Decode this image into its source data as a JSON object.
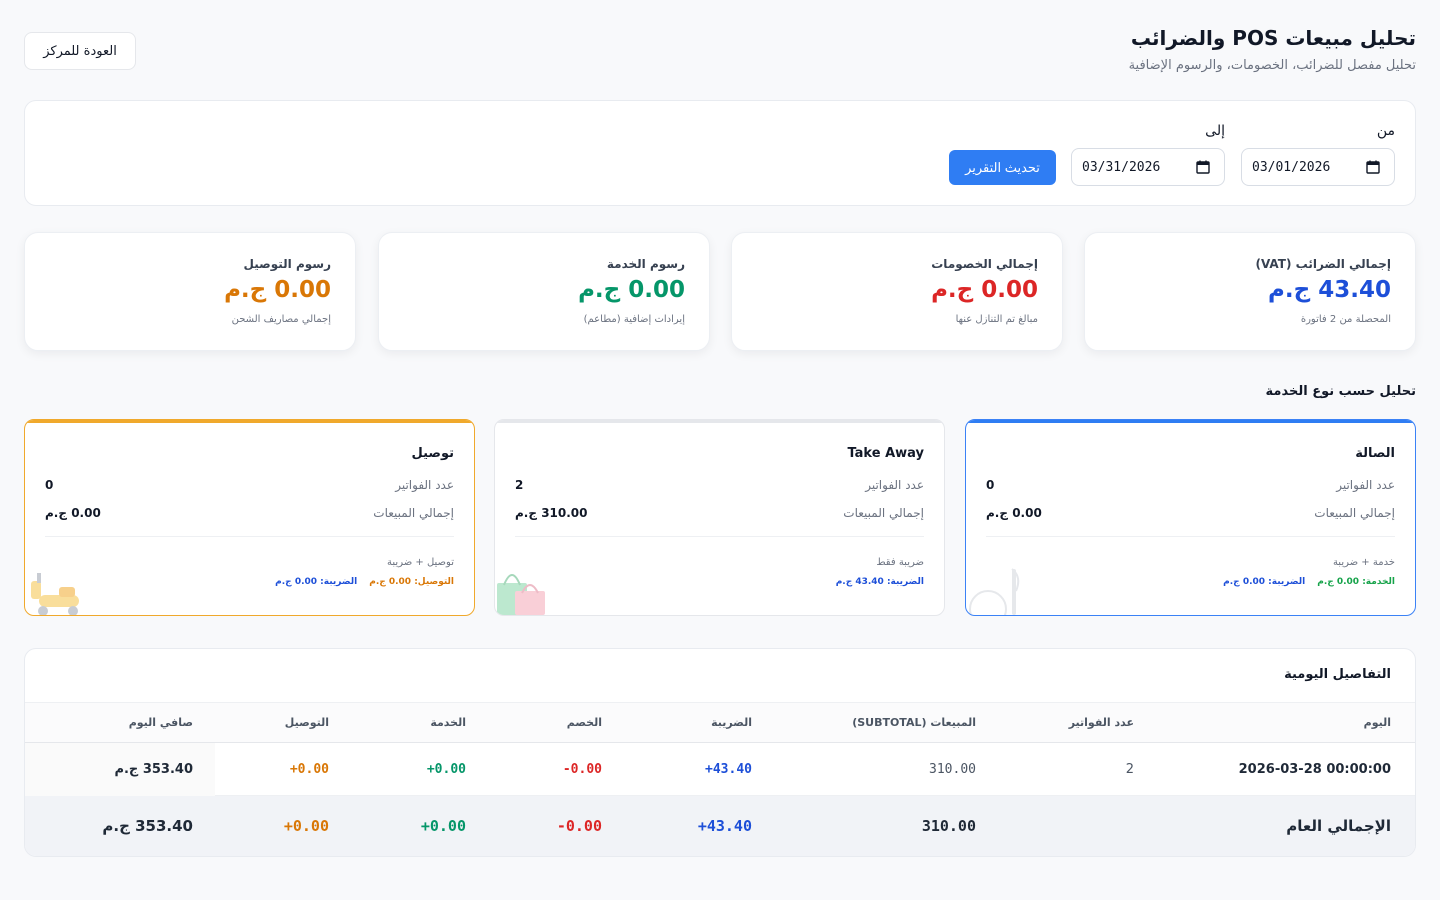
{
  "header": {
    "title": "تحليل مبيعات POS والضرائب",
    "subtitle": "تحليل مفصل للضرائب، الخصومات، والرسوم الإضافية",
    "back_label": "العودة للمركز"
  },
  "filters": {
    "from_label": "من",
    "to_label": "إلى",
    "from_value": "03/01/2026",
    "to_value": "03/31/2026",
    "refresh_label": "تحديث التقرير"
  },
  "stats": [
    {
      "label": "إجمالي الضرائب (VAT)",
      "value": "43.40 ج.م",
      "sub": "المحصلة من 2 فاتورة",
      "color": "#1d4fd8"
    },
    {
      "label": "إجمالي الخصومات",
      "value": "0.00 ج.م",
      "sub": "مبالغ تم التنازل عنها",
      "color": "#dc2626"
    },
    {
      "label": "رسوم الخدمة",
      "value": "0.00 ج.م",
      "sub": "إيرادات إضافية (مطاعم)",
      "color": "#059669"
    },
    {
      "label": "رسوم التوصيل",
      "value": "0.00 ج.م",
      "sub": "إجمالي مصاريف الشحن",
      "color": "#d97706"
    }
  ],
  "service_section_title": "تحليل حسب نوع الخدمة",
  "services": [
    {
      "name": "الصالة",
      "invoices_label": "عدد الفواتير",
      "invoices": "0",
      "sales_label": "إجمالي المبيعات",
      "sales": "0.00 ج.م",
      "note": "خدمة + ضريبة",
      "tags": [
        "الخدمة: 0.00 ج.م",
        "الضريبة: 0.00 ج.م"
      ],
      "accent": "#2f7df3",
      "icon": "dining-icon"
    },
    {
      "name": "Take Away",
      "invoices_label": "عدد الفواتير",
      "invoices": "2",
      "sales_label": "إجمالي المبيعات",
      "sales": "310.00 ج.م",
      "note": "ضريبة فقط",
      "tags": [
        "الضريبة: 43.40 ج.م"
      ],
      "accent": "#e5e7eb",
      "icon": "shopping-bags-icon"
    },
    {
      "name": "توصيل",
      "invoices_label": "عدد الفواتير",
      "invoices": "0",
      "sales_label": "إجمالي المبيعات",
      "sales": "0.00 ج.م",
      "note": "توصيل + ضريبة",
      "tags": [
        "التوصيل: 0.00 ج.م",
        "الضريبة: 0.00 ج.م"
      ],
      "accent": "#f0a92c",
      "icon": "scooter-icon"
    }
  ],
  "details": {
    "title": "التفاصيل اليومية",
    "columns": [
      "اليوم",
      "عدد الفواتير",
      "المبيعات (SUBTOTAL)",
      "الضريبة",
      "الخصم",
      "الخدمة",
      "التوصيل",
      "صافي اليوم"
    ],
    "rows": [
      {
        "day": "2026-03-28 00:00:00",
        "invoices": "2",
        "subtotal": "310.00",
        "tax": "+43.40",
        "discount": "-0.00",
        "service": "+0.00",
        "delivery": "+0.00",
        "net": "353.40 ج.م"
      }
    ],
    "totals": {
      "label": "الإجمالي العام",
      "subtotal": "310.00",
      "tax": "+43.40",
      "discount": "-0.00",
      "service": "+0.00",
      "delivery": "+0.00",
      "net": "353.40 ج.م"
    }
  }
}
